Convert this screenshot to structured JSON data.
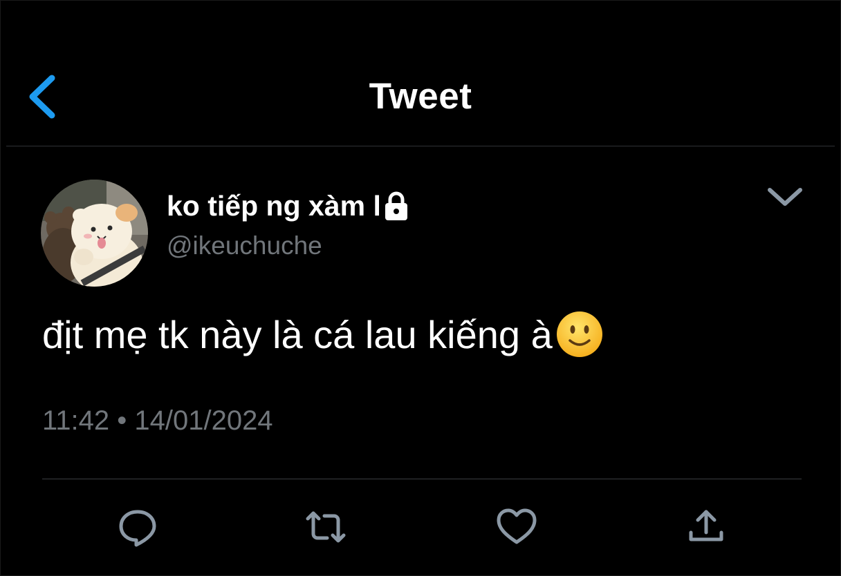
{
  "header": {
    "title": "Tweet",
    "back_icon": "chevron-left-icon",
    "accent_color": "#1d9bf0"
  },
  "tweet": {
    "author": {
      "display_name": "ko tiếp ng xàm l",
      "handle": "@ikeuchuche",
      "protected": true,
      "lock_icon": "lock-icon",
      "avatar_icon": "avatar-cartoon-icon"
    },
    "more_icon": "chevron-down-icon",
    "text": "địt mẹ tk này là cá lau kiếng à",
    "emoji": "slightly-smiling-face-icon",
    "timestamp": "11:42 • 14/01/2024"
  },
  "actions": [
    {
      "name": "reply",
      "icon": "reply-icon"
    },
    {
      "name": "retweet",
      "icon": "retweet-icon"
    },
    {
      "name": "like",
      "icon": "heart-icon"
    },
    {
      "name": "share",
      "icon": "share-icon"
    }
  ],
  "colors": {
    "background": "#000000",
    "primary_text": "#ffffff",
    "secondary_text": "#71767b",
    "icon_gray": "#8b98a5"
  }
}
